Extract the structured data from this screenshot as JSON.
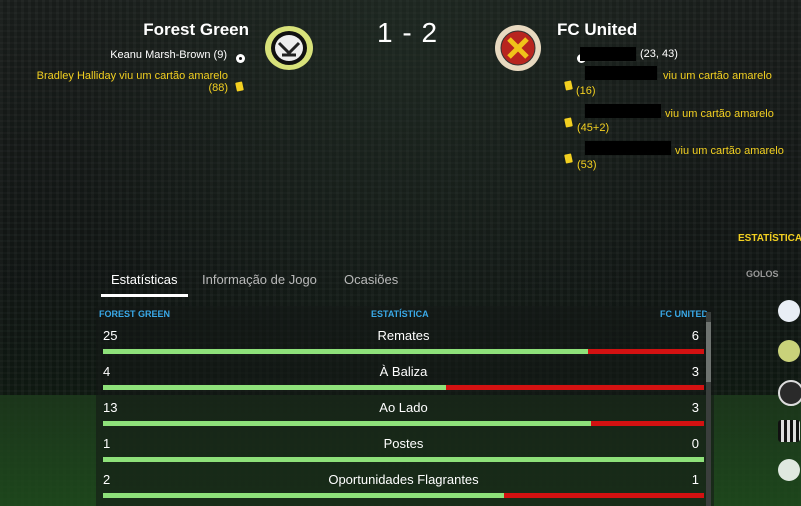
{
  "match": {
    "home": {
      "name": "Forest Green",
      "scorers": [
        {
          "text": "Keanu Marsh-Brown (9)"
        }
      ],
      "events": [
        {
          "text": "Bradley Halliday viu um cartão amarelo",
          "minute": "(88)"
        }
      ]
    },
    "away": {
      "name": "FC United",
      "scorer_minutes": "(23, 43)",
      "events": [
        {
          "text": "viu um cartão amarelo",
          "minute": "(16)"
        },
        {
          "text": "viu um cartão amarelo",
          "minute": "(45+2)"
        },
        {
          "text": "viu um cartão amarelo",
          "minute": "(53)"
        }
      ]
    },
    "score": "1 - 2"
  },
  "tabs": [
    "Estatísticas",
    "Informação de Jogo",
    "Ocasiões"
  ],
  "stats": {
    "header": {
      "home": "FOREST GREEN",
      "label": "ESTATÍSTICA",
      "away": "FC UNITED"
    },
    "rows": [
      {
        "home": 25,
        "label": "Remates",
        "away": 6
      },
      {
        "home": 4,
        "label": "À Baliza",
        "away": 3
      },
      {
        "home": 13,
        "label": "Ao Lado",
        "away": 3
      },
      {
        "home": 1,
        "label": "Postes",
        "away": 0
      },
      {
        "home": 2,
        "label": "Oportunidades Flagrantes",
        "away": 1
      }
    ]
  },
  "side_panel": {
    "stats_label": "ESTATÍSTICA",
    "goals_label": "GOLOS"
  },
  "colors": {
    "home_bar": "#8ee17a",
    "away_bar": "#d31111",
    "accent_blue": "#3aa9e8",
    "card_yellow": "#f3d021"
  },
  "icons": [
    "ball-icon",
    "yellow-card-icon",
    "forest-green-crest-icon",
    "fc-united-crest-icon"
  ]
}
